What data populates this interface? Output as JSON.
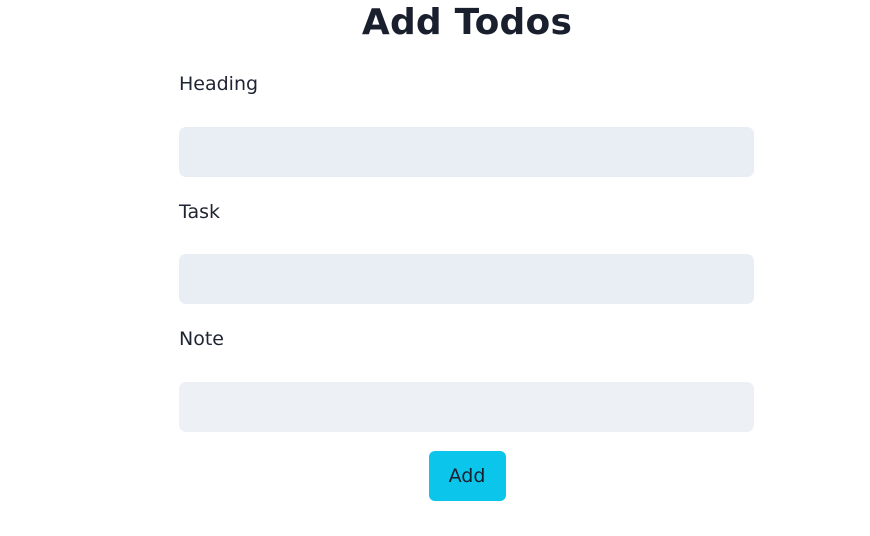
{
  "page": {
    "title": "Add Todos"
  },
  "form": {
    "fields": [
      {
        "label": "Heading",
        "value": "",
        "placeholder": ""
      },
      {
        "label": "Task",
        "value": "",
        "placeholder": ""
      },
      {
        "label": "Note",
        "value": "",
        "placeholder": ""
      }
    ],
    "submit_label": "Add"
  },
  "colors": {
    "input_background": "#e9eef5",
    "button_background": "#0bc5ea",
    "text": "#1a1f2e"
  }
}
